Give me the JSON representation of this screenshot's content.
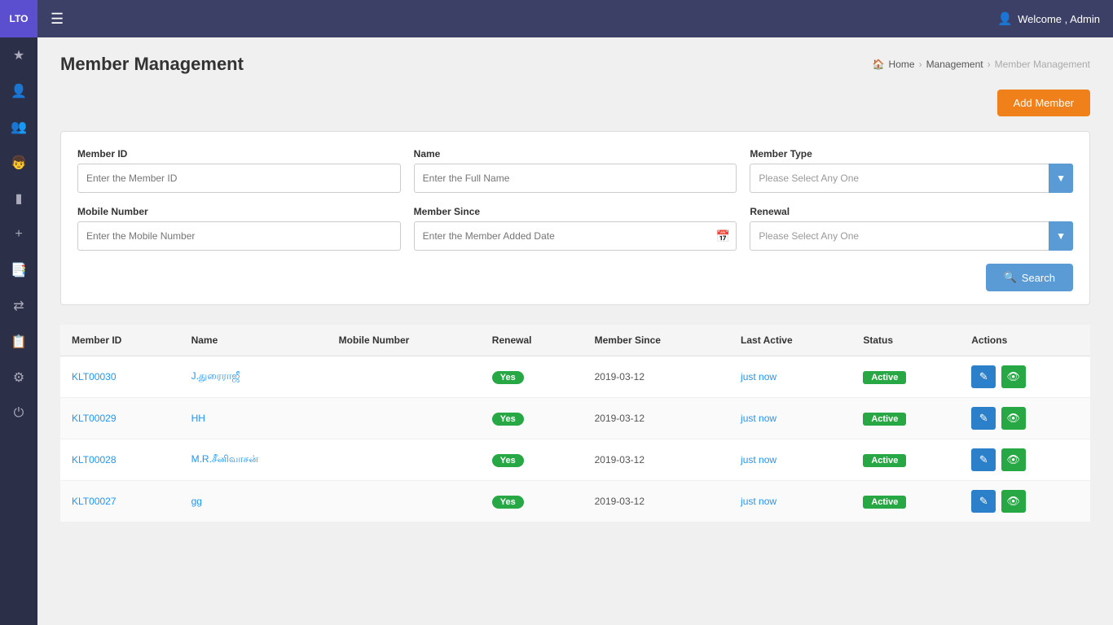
{
  "app": {
    "logo": "LTO",
    "menu_icon": "☰",
    "welcome_text": "Welcome , Admin"
  },
  "page": {
    "title": "Member Management",
    "breadcrumb": {
      "home": "Home",
      "management": "Management",
      "current": "Member Management"
    },
    "add_button_label": "Add Member"
  },
  "search_form": {
    "member_id_label": "Member ID",
    "member_id_placeholder": "Enter the Member ID",
    "name_label": "Name",
    "name_placeholder": "Enter the Full Name",
    "member_type_label": "Member Type",
    "member_type_placeholder": "Please Select Any One",
    "mobile_label": "Mobile Number",
    "mobile_placeholder": "Enter the Mobile Number",
    "member_since_label": "Member Since",
    "member_since_placeholder": "Enter the Member Added Date",
    "renewal_label": "Renewal",
    "renewal_placeholder": "Please Select Any One",
    "search_button": "Search"
  },
  "table": {
    "columns": [
      "Member ID",
      "Name",
      "Mobile Number",
      "Renewal",
      "Member Since",
      "Last Active",
      "Status",
      "Actions"
    ],
    "rows": [
      {
        "id": "KLT00030",
        "name": "J.துரைராஜீ",
        "mobile": "",
        "renewal": "Yes",
        "member_since": "2019-03-12",
        "last_active": "just now",
        "status": "Active"
      },
      {
        "id": "KLT00029",
        "name": "HH",
        "mobile": "",
        "renewal": "Yes",
        "member_since": "2019-03-12",
        "last_active": "just now",
        "status": "Active"
      },
      {
        "id": "KLT00028",
        "name": "M.R.சீனிவாசன்",
        "mobile": "",
        "renewal": "Yes",
        "member_since": "2019-03-12",
        "last_active": "just now",
        "status": "Active"
      },
      {
        "id": "KLT00027",
        "name": "gg",
        "mobile": "",
        "renewal": "Yes",
        "member_since": "2019-03-12",
        "last_active": "just now",
        "status": "Active"
      }
    ]
  },
  "sidebar_icons": [
    "🎨",
    "👥",
    "👨‍👩‍👧",
    "📋",
    "👤+",
    "📒",
    "⇄",
    "📝",
    "🔧",
    "⏻"
  ]
}
